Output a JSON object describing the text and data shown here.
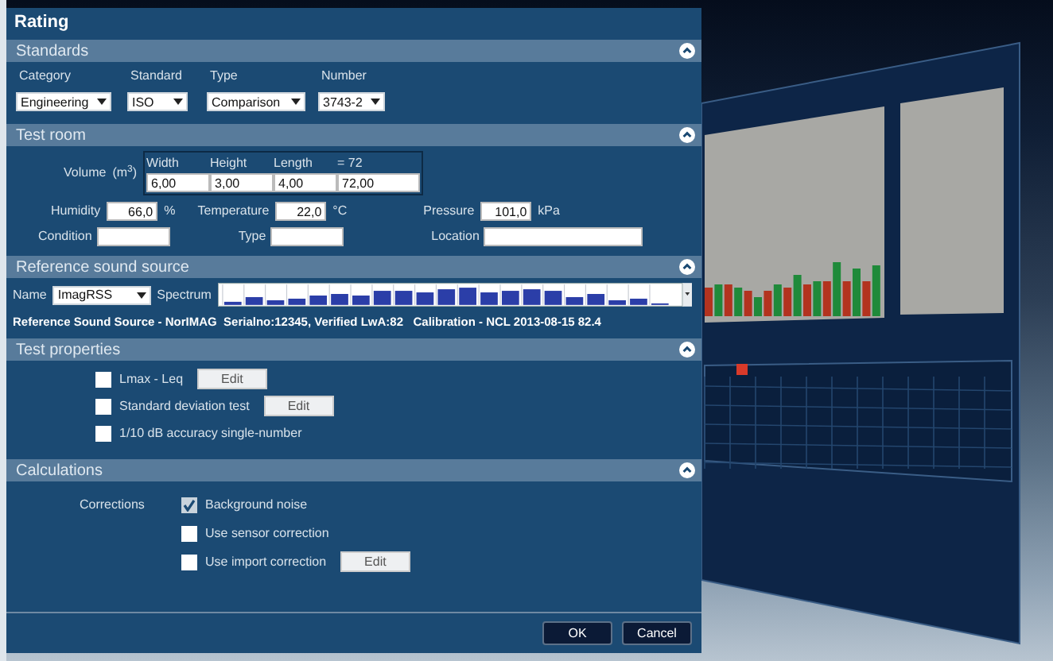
{
  "window": {
    "title": "Rating"
  },
  "sections": [
    {
      "kind": "standards",
      "title": "Standards",
      "expanded": true,
      "fields": [
        {
          "label": "Category",
          "value": "Engineering"
        },
        {
          "label": "Standard",
          "value": "ISO"
        },
        {
          "label": "Type",
          "value": "Comparison"
        },
        {
          "label": "Number",
          "value": "3743-2"
        }
      ]
    },
    {
      "kind": "test_room",
      "title": "Test room",
      "expanded": true,
      "volume": {
        "label": "Volume",
        "unit": "(m$^{3}$)",
        "columns": [
          {
            "label": "Width",
            "value": "6,00"
          },
          {
            "label": "Height",
            "value": "3,00"
          },
          {
            "label": "Length",
            "value": "4,00"
          },
          {
            "label": "= 72",
            "value": "72,00"
          }
        ]
      },
      "measurements": [
        {
          "label": "Humidity",
          "value": "66,0",
          "unit": "%"
        },
        {
          "label": "Temperature",
          "value": "22,0",
          "unit": "°C"
        },
        {
          "label": "Pressure",
          "value": "101,0",
          "unit": "kPa"
        }
      ],
      "details": [
        {
          "label": "Condition"
        },
        {
          "label": "Type"
        },
        {
          "label": "Location"
        }
      ]
    },
    {
      "kind": "reference",
      "title": "Reference sound source",
      "expanded": true,
      "name_label": "Name",
      "name_value": "ImagRSS",
      "spectrum_label": "Spectrum",
      "info": "Reference Sound Source - NorIMAG  Serialno:12345, Verified LwA:82   Calibration - NCL 2013-08-15 82.4"
    },
    {
      "kind": "options",
      "title": "Test properties",
      "expanded": true,
      "options": [
        {
          "label": "Lmax - Leq",
          "checked": false,
          "button": "Edit"
        },
        {
          "label": "Standard deviation test",
          "checked": false,
          "button": "Edit"
        },
        {
          "label": "1/10 dB accuracy single-number",
          "checked": false
        }
      ]
    },
    {
      "kind": "calculations",
      "title": "Calculations",
      "expanded": true,
      "group_label": "Corrections",
      "options": [
        {
          "label": "Background noise",
          "checked": true
        },
        {
          "label": "Use sensor correction",
          "checked": false
        },
        {
          "label": "Use import correction",
          "checked": false,
          "button": "Edit"
        }
      ]
    }
  ],
  "buttons": [
    {
      "label": "OK"
    },
    {
      "label": "Cancel"
    }
  ]
}
